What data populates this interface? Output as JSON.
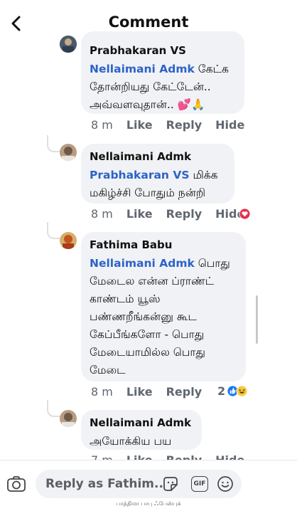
{
  "header": {
    "title": "Comment"
  },
  "actions": {
    "like": "Like",
    "reply": "Reply",
    "hide": "Hide"
  },
  "comments": [
    {
      "author": "Prabhakaran VS",
      "mention": "Nellaimani Admk",
      "text": " கேட்க தோன்றியது கேட்டேன்.. அவ்வளவுதான்.. 💕🙏",
      "time": "8 m"
    },
    {
      "author": "Nellaimani Admk",
      "mention": "Prabhakaran VS",
      "text": " மிக்க மகிழ்ச்சி போதும் நன்றி",
      "time": "8 m"
    },
    {
      "author": "Fathima Babu",
      "mention": "Nellaimani Admk",
      "text": " பொது மேடைல என்ன ப்ராண்ட் காண்டம் யூஸ் பண்ணறீங்கன்னு கூட கேப்பீங்களோ - பொது மேடையாமில்ல பொது மேடை",
      "time": "8 m",
      "reaction_count": "2"
    },
    {
      "author": "Nellaimani Admk",
      "mention": "",
      "text": "அயோக்கிய பய",
      "time": "7 m"
    }
  ],
  "composer": {
    "placeholder": "Reply as Fathim...",
    "gif_label": "GIF"
  },
  "footer": {
    "text": "பாத்திமா பாபு ஃபேஸ்புக்"
  },
  "colors": {
    "mention": "#2d62c8",
    "bubble": "#f0f2f5",
    "love": "#e8304a",
    "like": "#1877f2",
    "haha": "#f7c93f"
  }
}
